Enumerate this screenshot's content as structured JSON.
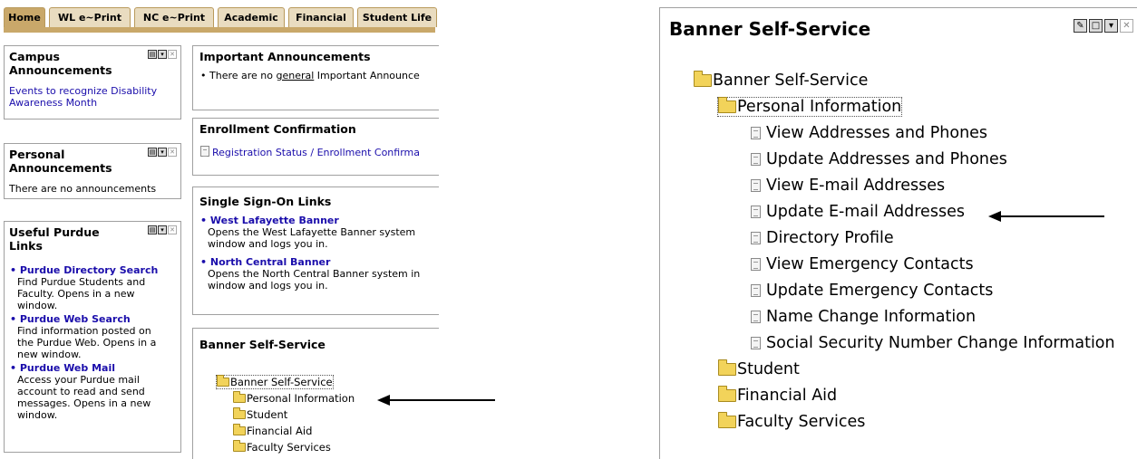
{
  "tabs": [
    "Home",
    "WL e~Print",
    "NC e~Print",
    "Academic",
    "Financial",
    "Student Life"
  ],
  "campus_announcements": {
    "title_line1": "Campus",
    "title_line2": "Announcements",
    "link_line1": "Events to recognize Disability",
    "link_line2": "Awareness Month"
  },
  "personal_announcements": {
    "title_line1": "Personal",
    "title_line2": "Announcements",
    "text": "There are no announcements"
  },
  "useful_links": {
    "title_line1": "Useful Purdue",
    "title_line2": "Links",
    "items": [
      {
        "title": "Purdue Directory Search",
        "desc": [
          "Find Purdue Students and",
          "Faculty. Opens in a new",
          "window."
        ]
      },
      {
        "title": "Purdue Web Search",
        "desc": [
          "Find information posted on",
          "the Purdue Web. Opens in a",
          "new window."
        ]
      },
      {
        "title": "Purdue Web Mail",
        "desc": [
          "Access your Purdue mail",
          "account to read and send",
          "messages. Opens in a new",
          "window."
        ]
      }
    ]
  },
  "important_announcements": {
    "title": "Important Announcements",
    "text_before": "There are no ",
    "text_link": "general",
    "text_after": " Important Announce"
  },
  "enrollment": {
    "title": "Enrollment Confirmation",
    "link": "Registration Status / Enrollment Confirma"
  },
  "sso": {
    "title": "Single Sign-On Links",
    "items": [
      {
        "title": "West Lafayette Banner",
        "desc": [
          "Opens the West Lafayette Banner system",
          "window and logs you in."
        ]
      },
      {
        "title": "North Central Banner",
        "desc": [
          "Opens the North Central Banner system in",
          "window and logs you in."
        ]
      }
    ]
  },
  "banner_small": {
    "title": "Banner Self-Service",
    "root": "Banner Self-Service",
    "folders": [
      "Personal Information",
      "Student",
      "Financial Aid",
      "Faculty Services"
    ]
  },
  "banner_large": {
    "title": "Banner Self-Service",
    "root": "Banner Self-Service",
    "open_folder": "Personal Information",
    "pages": [
      "View Addresses and Phones",
      "Update Addresses and Phones",
      "View E-mail Addresses",
      "Update E-mail Addresses",
      "Directory Profile",
      "View Emergency Contacts",
      "Update Emergency Contacts",
      "Name Change Information",
      "Social Security Number Change Information"
    ],
    "folders": [
      "Student",
      "Financial Aid",
      "Faculty Services"
    ]
  },
  "colors": {
    "tab_bar": "#c9a86a",
    "tab": "#e9dcc0",
    "link": "#1a0dab",
    "folder": "#f2d35a"
  }
}
